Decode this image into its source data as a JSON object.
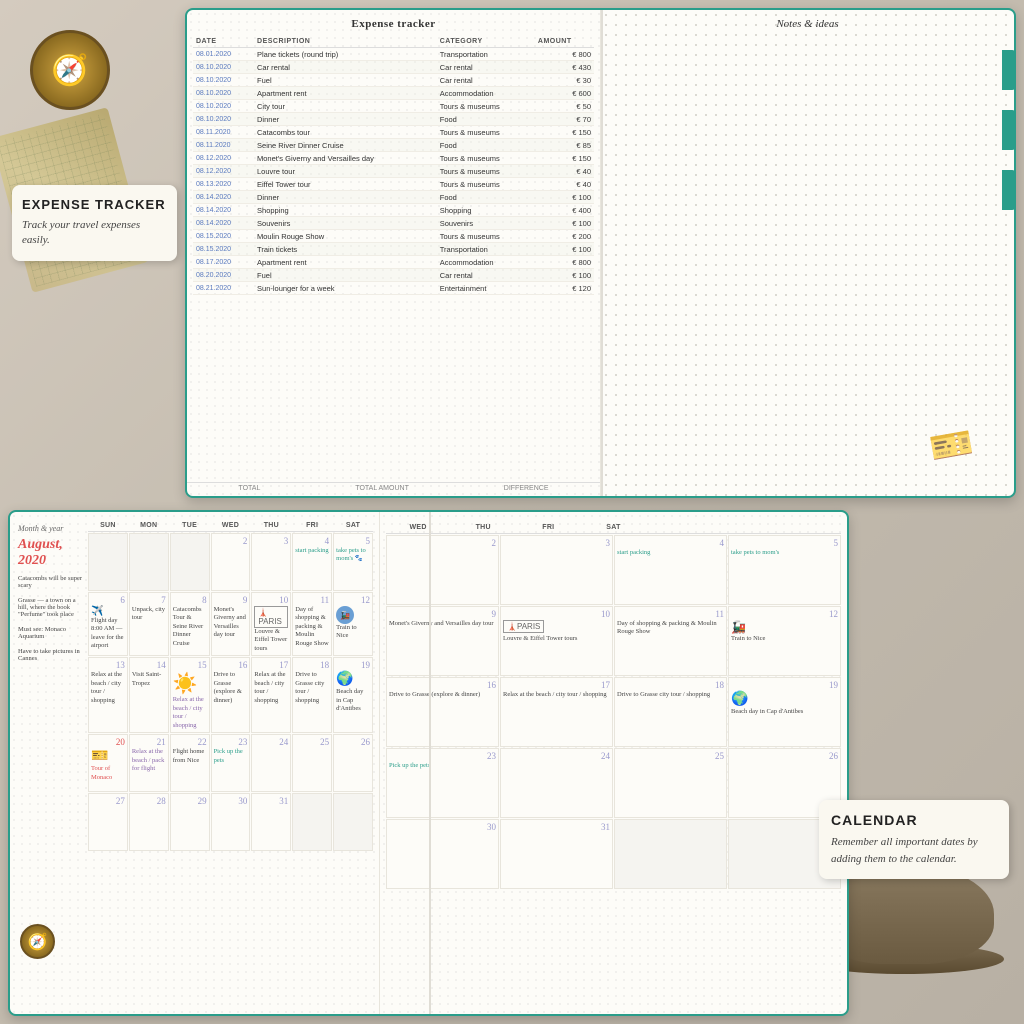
{
  "background": {
    "color": "#c8c0b0"
  },
  "expense_label": {
    "title": "EXPENSE TRACKER",
    "subtitle": "Track your travel expenses easily."
  },
  "calendar_label": {
    "title": "CALENDAR",
    "subtitle": "Remember all important dates by adding them to the calendar."
  },
  "expense_tracker": {
    "page_title": "Expense tracker",
    "notes_title": "Notes & ideas",
    "columns": [
      "DATE",
      "DESCRIPTION",
      "CATEGORY",
      "AMOUNT"
    ],
    "rows": [
      {
        "date": "08.01.2020",
        "description": "Plane tickets (round trip)",
        "category": "Transportation",
        "amount": "€ 800"
      },
      {
        "date": "08.10.2020",
        "description": "Car rental",
        "category": "Car rental",
        "amount": "€ 430"
      },
      {
        "date": "08.10.2020",
        "description": "Fuel",
        "category": "Car rental",
        "amount": "€ 30"
      },
      {
        "date": "08.10.2020",
        "description": "Apartment rent",
        "category": "Accommodation",
        "amount": "€ 600"
      },
      {
        "date": "08.10.2020",
        "description": "City tour",
        "category": "Tours & museums",
        "amount": "€ 50"
      },
      {
        "date": "08.10.2020",
        "description": "Dinner",
        "category": "Food",
        "amount": "€ 70"
      },
      {
        "date": "08.11.2020",
        "description": "Catacombs tour",
        "category": "Tours & museums",
        "amount": "€ 150"
      },
      {
        "date": "08.11.2020",
        "description": "Seine River Dinner Cruise",
        "category": "Food",
        "amount": "€ 85"
      },
      {
        "date": "08.12.2020",
        "description": "Monet's Giverny and Versailles day",
        "category": "Tours & museums",
        "amount": "€ 150"
      },
      {
        "date": "08.12.2020",
        "description": "Louvre tour",
        "category": "Tours & museums",
        "amount": "€ 40"
      },
      {
        "date": "08.13.2020",
        "description": "Eiffel Tower tour",
        "category": "Tours & museums",
        "amount": "€ 40"
      },
      {
        "date": "08.14.2020",
        "description": "Dinner",
        "category": "Food",
        "amount": "€ 100"
      },
      {
        "date": "08.14.2020",
        "description": "Shopping",
        "category": "Shopping",
        "amount": "€ 400"
      },
      {
        "date": "08.14.2020",
        "description": "Souvenirs",
        "category": "Souvenirs",
        "amount": "€ 100"
      },
      {
        "date": "08.15.2020",
        "description": "Moulin Rouge Show",
        "category": "Tours & museums",
        "amount": "€ 200"
      },
      {
        "date": "08.15.2020",
        "description": "Train tickets",
        "category": "Transportation",
        "amount": "€ 100"
      },
      {
        "date": "08.17.2020",
        "description": "Apartment rent",
        "category": "Accommodation",
        "amount": "€ 800"
      },
      {
        "date": "08.20.2020",
        "description": "Fuel",
        "category": "Car rental",
        "amount": "€ 100"
      },
      {
        "date": "08.21.2020",
        "description": "Sun-lounger for a week",
        "category": "Entertainment",
        "amount": "€ 120"
      }
    ]
  },
  "calendar": {
    "month_year_label": "Month & year",
    "month_highlight": "August, 2020",
    "days_of_week": [
      "SUNDAY",
      "MONDAY",
      "TUESDAY",
      "WEDNESDAY",
      "THURSDAY",
      "FRIDAY",
      "SATURDAY"
    ],
    "sidebar_notes": [
      "Catacombs will be super scary",
      "Grasse — a town on a hill, where the book \"Perfume\" took place",
      "Must see: Monaco Aquarium",
      "Have to take pictures in Cannes"
    ],
    "left_weeks": [
      [
        {
          "num": "",
          "empty": true
        },
        {
          "num": "",
          "empty": true
        },
        {
          "num": "",
          "empty": true
        },
        {
          "num": "2",
          "event": "",
          "style": ""
        },
        {
          "num": "3",
          "event": "",
          "style": ""
        },
        {
          "num": "4",
          "event": "start packing",
          "style": "teal"
        },
        {
          "num": "5",
          "event": "take pets to mom's",
          "style": "teal"
        }
      ],
      [
        {
          "num": "6",
          "event": "Flight day 8:00 AM — leave for the airport",
          "style": ""
        },
        {
          "num": "7",
          "event": "Unpack, city tour",
          "style": ""
        },
        {
          "num": "8",
          "event": "Catacombs Tour & Seine River Dinner Cruise",
          "style": ""
        },
        {
          "num": "9",
          "event": "Monet's Giverny and Versailles day tour",
          "style": ""
        },
        {
          "num": "10",
          "event": "Louvre & Eiffel Tower tours",
          "style": "",
          "stamp": true
        },
        {
          "num": "11",
          "event": "Day of shopping & packing & Moulin Rouge Show",
          "style": ""
        },
        {
          "num": "12",
          "event": "Train to Nice",
          "style": "",
          "train": true
        }
      ],
      [
        {
          "num": "13",
          "event": "Relax at the beach / city tour / shopping",
          "style": ""
        },
        {
          "num": "14",
          "event": "Visit Saint-Tropez",
          "style": ""
        },
        {
          "num": "15",
          "event": "Relax at the beach / city tour / shopping",
          "style": "purple"
        },
        {
          "num": "16",
          "event": "Drive to Grasse (explore & dinner)",
          "style": ""
        },
        {
          "num": "17",
          "event": "Relax at the beach / city tour / shopping",
          "style": ""
        },
        {
          "num": "18",
          "event": "Drive to Grasse city tour / shopping",
          "style": ""
        },
        {
          "num": "19",
          "event": "Beach day in Cap d'Antibes",
          "style": "",
          "globe": true
        }
      ],
      [
        {
          "num": "20",
          "event": "Tour of Monaco",
          "style": "red",
          "tickets": true
        },
        {
          "num": "21",
          "event": "Relax at the beach / pack for flight",
          "style": "purple"
        },
        {
          "num": "22",
          "event": "Flight home from Nice",
          "style": ""
        },
        {
          "num": "23",
          "event": "Pick up the pets",
          "style": "teal"
        },
        {
          "num": "24",
          "event": "",
          "style": ""
        },
        {
          "num": "25",
          "event": "",
          "style": ""
        },
        {
          "num": "26",
          "event": "",
          "style": ""
        }
      ],
      [
        {
          "num": "27",
          "event": "",
          "style": ""
        },
        {
          "num": "28",
          "event": "",
          "style": ""
        },
        {
          "num": "29",
          "event": "",
          "style": ""
        },
        {
          "num": "30",
          "event": "",
          "style": ""
        },
        {
          "num": "31",
          "event": "",
          "style": ""
        },
        {
          "num": "",
          "empty": true
        },
        {
          "num": "",
          "empty": true
        }
      ]
    ]
  }
}
